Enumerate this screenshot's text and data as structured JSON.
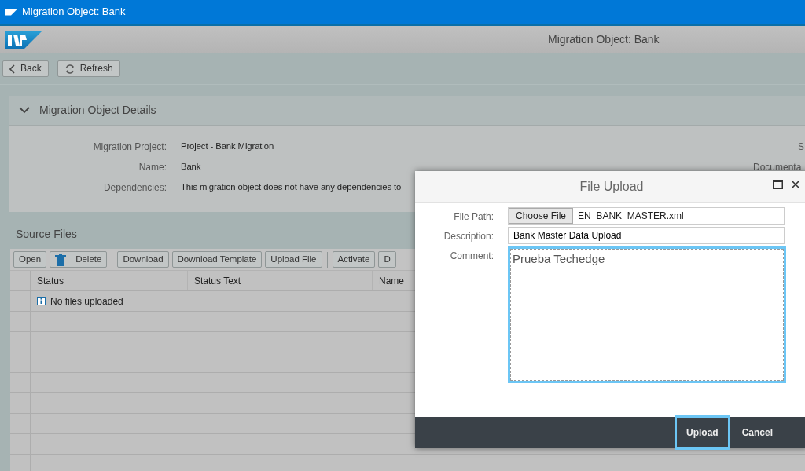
{
  "window": {
    "title": "Migration Object: Bank"
  },
  "header": {
    "title": "Migration Object: Bank"
  },
  "toolbar": [
    {
      "label": "Back",
      "separated": false
    },
    {
      "label": "Refresh",
      "separated": true
    }
  ],
  "details": {
    "title": "Migration Object Details",
    "expanded": true,
    "fields": [
      {
        "label": "Migration Project:",
        "value": "Project - Bank Migration"
      },
      {
        "label": "Name:",
        "value": "Bank"
      },
      {
        "label": "Dependencies:",
        "value": "This migration object does not have any dependencies to"
      }
    ],
    "side_labels": [
      "S",
      "Documenta"
    ]
  },
  "source_files": {
    "title": "Source Files",
    "actions": [
      {
        "label": "Open",
        "separated": false
      },
      {
        "label": "Delete",
        "separated": false
      },
      {
        "label": "Download",
        "separated": true
      },
      {
        "label": "Download Template",
        "separated": false
      },
      {
        "label": "Upload File",
        "separated": false
      },
      {
        "label": "Activate",
        "separated": true
      },
      {
        "label": "D",
        "separated": false
      }
    ],
    "columns": [
      "Status",
      "Status Text",
      "Name"
    ],
    "rows": [
      {
        "kind": "info",
        "status": "No files uploaded"
      }
    ]
  },
  "dialog": {
    "title": "File Upload",
    "fields": [
      {
        "kind": "file",
        "label": "File Path:",
        "button": "Choose File",
        "value": "EN_BANK_MASTER.xml"
      },
      {
        "kind": "text",
        "label": "Description:",
        "value": "Bank Master Data Upload"
      },
      {
        "kind": "textarea",
        "label": "Comment:",
        "value": "Prueba Techedge",
        "focused": true
      }
    ],
    "buttons": [
      {
        "label": "Upload",
        "focused": true
      },
      {
        "label": "Cancel",
        "focused": false
      }
    ]
  }
}
